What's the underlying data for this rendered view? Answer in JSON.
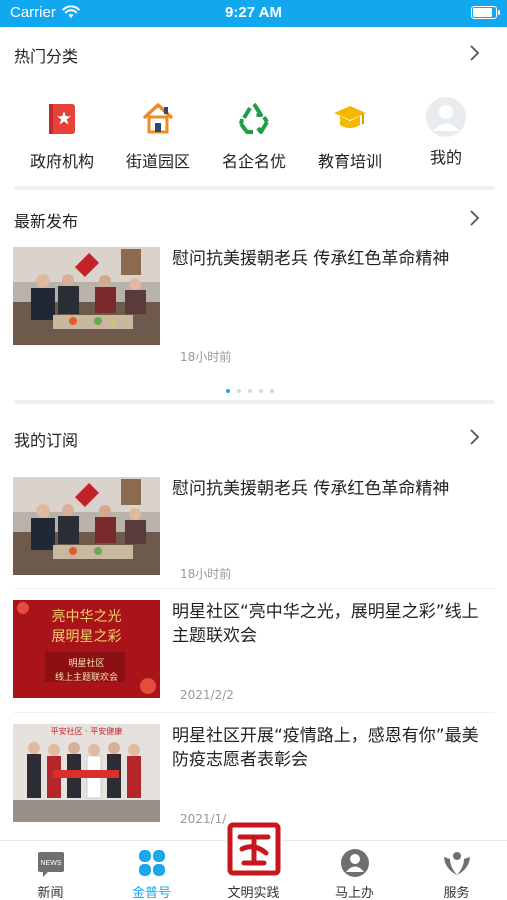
{
  "status_bar": {
    "carrier": "Carrier",
    "time": "9:27 AM",
    "battery_level": 0.9
  },
  "colors": {
    "status_bar": "#12a8f0",
    "accent": "#1aa7ec",
    "divider": "#eef0f2",
    "muted_text": "#999999"
  },
  "hot_categories": {
    "title": "热门分类",
    "items": [
      {
        "label": "政府机构",
        "icon": "government-flag-icon"
      },
      {
        "label": "街道园区",
        "icon": "house-icon"
      },
      {
        "label": "名企名优",
        "icon": "recycle-icon"
      },
      {
        "label": "教育培训",
        "icon": "graduation-cap-icon"
      },
      {
        "label": "我的",
        "icon": "user-avatar-icon"
      }
    ]
  },
  "latest": {
    "title": "最新发布",
    "article": {
      "title": "慰问抗美援朝老兵  传承红色革命精神",
      "time": "18小时前"
    },
    "pager": {
      "count": 5,
      "active": 0
    }
  },
  "subscriptions": {
    "title": "我的订阅",
    "articles": [
      {
        "title": "慰问抗美援朝老兵  传承红色革命精神",
        "time": "18小时前"
      },
      {
        "title": "明星社区“亮中华之光，展明星之彩”线上主题联欢会",
        "time": "2021/2/2",
        "poster": {
          "headline": "亮中华之光",
          "headline2": "展明星之彩",
          "org": "明星社区",
          "sub": "线上主题联欢会"
        }
      },
      {
        "title": "明星社区开展“疫情路上，感恩有你”最美防疫志愿者表彰会",
        "time": "2021/1/",
        "banner": "平安社区 · 平安健康"
      }
    ]
  },
  "tabbar": {
    "tabs": [
      {
        "label": "新闻",
        "icon": "news-icon",
        "badge": "NEWS"
      },
      {
        "label": "金普号",
        "icon": "clover-icon",
        "active": true
      },
      {
        "label": "文明实践",
        "icon": "civilization-seal-icon"
      },
      {
        "label": "马上办",
        "icon": "person-icon"
      },
      {
        "label": "服务",
        "icon": "service-hands-icon"
      }
    ]
  }
}
